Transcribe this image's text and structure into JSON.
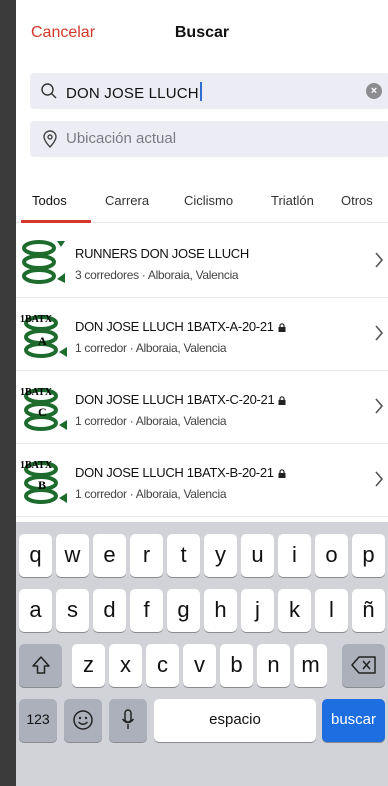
{
  "header": {
    "cancel_label": "Cancelar",
    "title": "Buscar"
  },
  "search": {
    "value": "DON JOSE LLUCH",
    "clear_icon": "clear-icon"
  },
  "location": {
    "placeholder": "Ubicación actual"
  },
  "tabs": [
    {
      "label": "Todos",
      "active": true
    },
    {
      "label": "Carrera"
    },
    {
      "label": "Ciclismo"
    },
    {
      "label": "Triatlón"
    },
    {
      "label": "Otros"
    }
  ],
  "clubs": [
    {
      "name": "RUNNERS DON JOSE LLUCH",
      "subtitle": "3 corredores · Alboraia, Valencia",
      "private": false
    },
    {
      "name": "DON JOSE LLUCH 1BATX-A-20-21",
      "subtitle": "1 corredor · Alboraia, Valencia",
      "private": true,
      "logo_text": "1BATX",
      "logo_letter": "A"
    },
    {
      "name": "DON JOSE LLUCH 1BATX-C-20-21",
      "subtitle": "1 corredor · Alboraia, Valencia",
      "private": true,
      "logo_text": "1BATX",
      "logo_letter": "C"
    },
    {
      "name": "DON JOSE LLUCH 1BATX-B-20-21",
      "subtitle": "1 corredor · Alboraia, Valencia",
      "private": true,
      "logo_text": "1BATX",
      "logo_letter": "B"
    }
  ],
  "keyboard": {
    "row1": [
      "q",
      "w",
      "e",
      "r",
      "t",
      "y",
      "u",
      "i",
      "o",
      "p"
    ],
    "row2": [
      "a",
      "s",
      "d",
      "f",
      "g",
      "h",
      "j",
      "k",
      "l",
      "ñ"
    ],
    "row3": [
      "z",
      "x",
      "c",
      "v",
      "b",
      "n",
      "m"
    ],
    "numbers_label": "123",
    "space_label": "espacio",
    "go_label": "buscar"
  },
  "colors": {
    "accent": "#d0382a",
    "keyboard_go": "#1d6ee0",
    "logo_green": "#1e6b2e"
  }
}
